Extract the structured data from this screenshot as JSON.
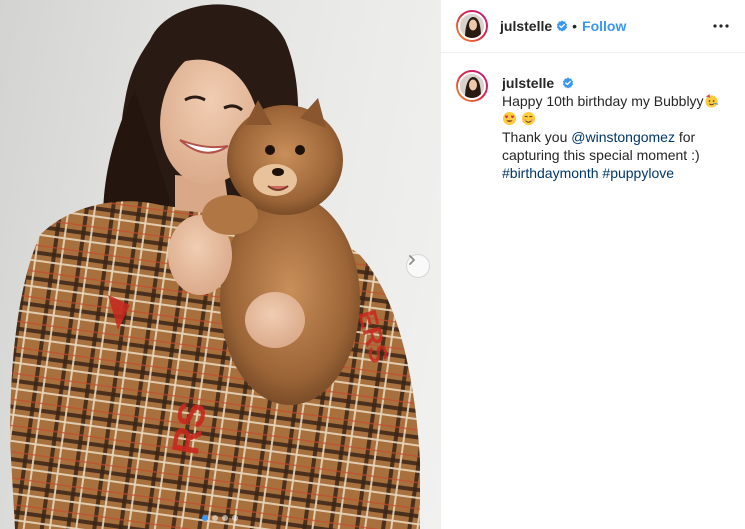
{
  "post": {
    "username": "julstelle",
    "separator": "•",
    "follow_label": "Follow",
    "more_label": "More options",
    "caption": {
      "username": "julstelle",
      "line1": "Happy 10th birthday my Bubblyy",
      "line3_prefix": "Thank you ",
      "mention": "@winstongomez",
      "line3_suffix": " for",
      "line4": "capturing this special moment :)",
      "hashtag1": "#birthdaymonth",
      "hashtag2": "#puppylove"
    }
  },
  "media": {
    "carousel_index": 1,
    "carousel_count": 4
  },
  "colors": {
    "accent": "#3897f0",
    "link": "#00376b",
    "text": "#262626",
    "border": "#efefef"
  },
  "icons": {
    "verified": "verified-badge-icon",
    "next": "chevron-right-icon",
    "more": "ellipsis-icon"
  }
}
